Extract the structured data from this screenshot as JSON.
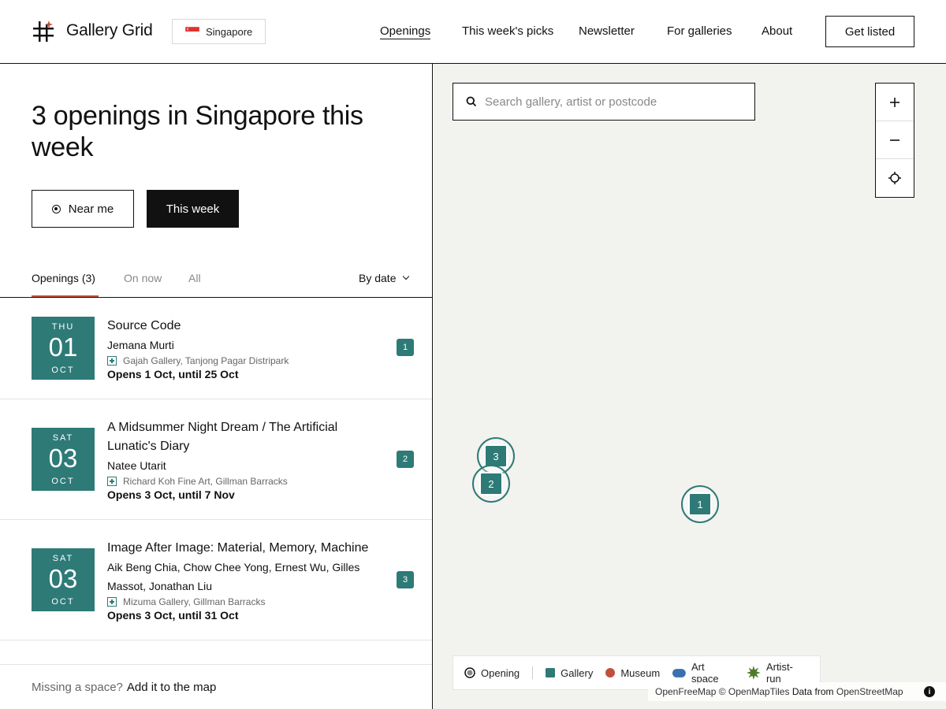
{
  "header": {
    "brand": "Gallery Grid",
    "country": "Singapore",
    "nav": [
      "Openings",
      "This week's picks",
      "Newsletter",
      "For galleries",
      "About"
    ],
    "get_listed": "Get listed"
  },
  "panel": {
    "title": "3 openings in Singapore this week",
    "near_me": "Near me",
    "this_week": "This week",
    "tabs": [
      "Openings (3)",
      "On now",
      "All"
    ],
    "sort": "By date"
  },
  "openings": [
    {
      "dow": "THU",
      "day": "01",
      "month": "OCT",
      "title": "Source Code",
      "artists": "Jemana Murti",
      "venue": "Gajah Gallery, Tanjong Pagar Distripark",
      "dates": "Opens 1 Oct, until 25 Oct",
      "number": "1"
    },
    {
      "dow": "SAT",
      "day": "03",
      "month": "OCT",
      "title": "A Midsummer Night Dream / The Artificial Lunatic's Diary",
      "artists": "Natee Utarit",
      "venue": "Richard Koh Fine Art, Gillman Barracks",
      "dates": "Opens 3 Oct, until 7 Nov",
      "number": "2"
    },
    {
      "dow": "SAT",
      "day": "03",
      "month": "OCT",
      "title": "Image After Image: Material, Memory, Machine",
      "artists": "Aik Beng Chia, Chow Chee Yong, Ernest Wu, Gilles Massot, Jonathan Liu",
      "venue": "Mizuma Gallery, Gillman Barracks",
      "dates": "Opens 3 Oct, until 31 Oct",
      "number": "3"
    }
  ],
  "footer": {
    "missing": "Missing a space?",
    "add": "Add it to the map"
  },
  "map": {
    "search_placeholder": "Search gallery, artist or postcode",
    "markers": [
      "3",
      "2",
      "1"
    ],
    "legend": [
      "Opening",
      "Gallery",
      "Museum",
      "Art space",
      "Artist-run"
    ],
    "attribution": {
      "a": "OpenFreeMap",
      "b": "© OpenMapTiles",
      "c": "Data from",
      "d": "OpenStreetMap"
    }
  },
  "colors": {
    "gallery": "#2e7a77",
    "museum": "#c0503a",
    "art_space": "#3a6fb0",
    "artist_run": "#4d7a2a",
    "accent": "#c0503a"
  }
}
